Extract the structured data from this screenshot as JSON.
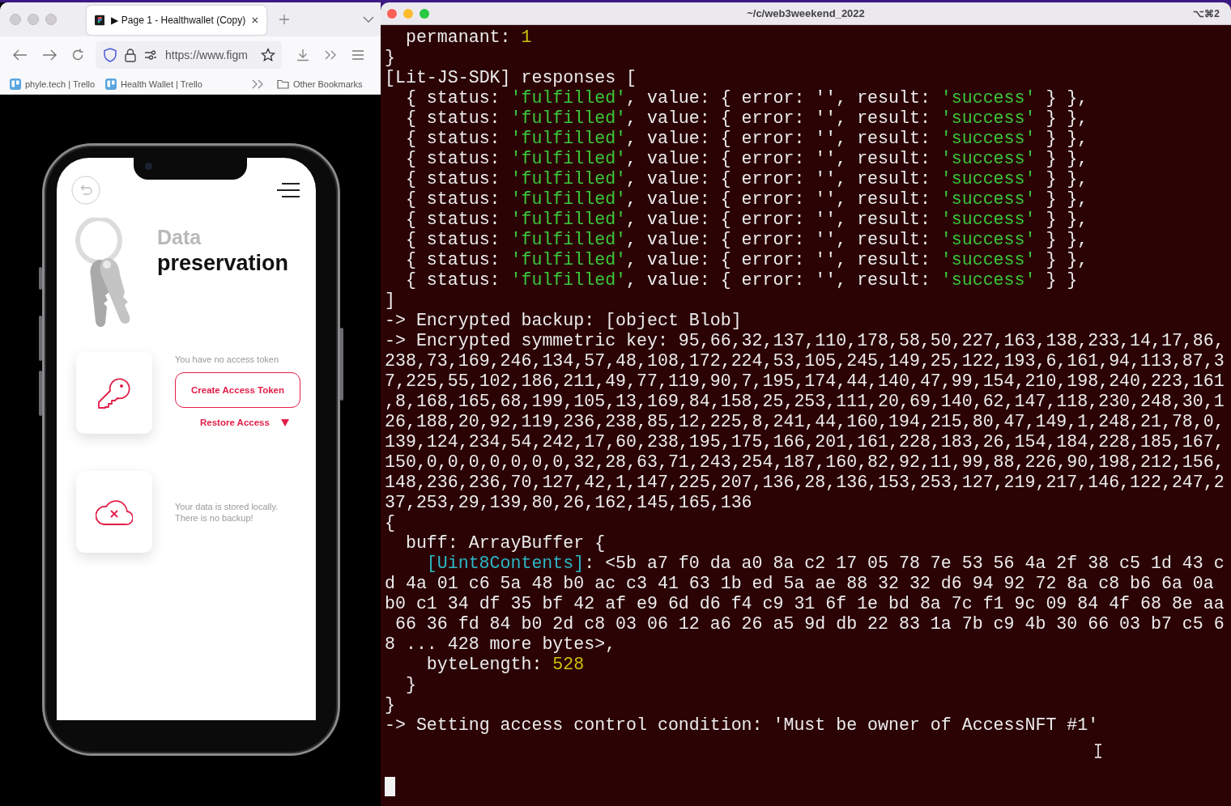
{
  "browser": {
    "tabs": [
      {
        "title": "▶ Page 1 - Healthwallet (Copy)",
        "selected": true
      }
    ],
    "url": "https://www.figm",
    "bookmarks": [
      {
        "label": "phyle.tech | Trello"
      },
      {
        "label": "Health Wallet | Trello"
      }
    ],
    "other_bookmarks": "Other Bookmarks"
  },
  "app": {
    "title_light": "Data",
    "title_bold": "preservation",
    "token_section": {
      "message": "You have no access token",
      "button": "Create Access Token",
      "link": "Restore Access"
    },
    "backup_section": {
      "message": "Your data is stored locally. There is no backup!"
    }
  },
  "terminal": {
    "title": "~/c/web3weekend_2022",
    "shortcut": "⌥⌘2",
    "lines": [
      [
        {
          "text": "  permanant: ",
          "kind": "plain"
        },
        {
          "text": "1",
          "kind": "number"
        }
      ],
      [
        {
          "text": "}",
          "kind": "plain"
        }
      ],
      [
        {
          "text": "[Lit-JS-SDK] responses [",
          "kind": "plain"
        }
      ],
      [
        {
          "text": "  { status: ",
          "kind": "plain"
        },
        {
          "text": "'fulfilled'",
          "kind": "string"
        },
        {
          "text": ", value: { error: '', result: ",
          "kind": "plain"
        },
        {
          "text": "'success'",
          "kind": "string"
        },
        {
          "text": " } },",
          "kind": "plain"
        }
      ],
      [
        {
          "text": "  { status: ",
          "kind": "plain"
        },
        {
          "text": "'fulfilled'",
          "kind": "string"
        },
        {
          "text": ", value: { error: '', result: ",
          "kind": "plain"
        },
        {
          "text": "'success'",
          "kind": "string"
        },
        {
          "text": " } },",
          "kind": "plain"
        }
      ],
      [
        {
          "text": "  { status: ",
          "kind": "plain"
        },
        {
          "text": "'fulfilled'",
          "kind": "string"
        },
        {
          "text": ", value: { error: '', result: ",
          "kind": "plain"
        },
        {
          "text": "'success'",
          "kind": "string"
        },
        {
          "text": " } },",
          "kind": "plain"
        }
      ],
      [
        {
          "text": "  { status: ",
          "kind": "plain"
        },
        {
          "text": "'fulfilled'",
          "kind": "string"
        },
        {
          "text": ", value: { error: '', result: ",
          "kind": "plain"
        },
        {
          "text": "'success'",
          "kind": "string"
        },
        {
          "text": " } },",
          "kind": "plain"
        }
      ],
      [
        {
          "text": "  { status: ",
          "kind": "plain"
        },
        {
          "text": "'fulfilled'",
          "kind": "string"
        },
        {
          "text": ", value: { error: '', result: ",
          "kind": "plain"
        },
        {
          "text": "'success'",
          "kind": "string"
        },
        {
          "text": " } },",
          "kind": "plain"
        }
      ],
      [
        {
          "text": "  { status: ",
          "kind": "plain"
        },
        {
          "text": "'fulfilled'",
          "kind": "string"
        },
        {
          "text": ", value: { error: '', result: ",
          "kind": "plain"
        },
        {
          "text": "'success'",
          "kind": "string"
        },
        {
          "text": " } },",
          "kind": "plain"
        }
      ],
      [
        {
          "text": "  { status: ",
          "kind": "plain"
        },
        {
          "text": "'fulfilled'",
          "kind": "string"
        },
        {
          "text": ", value: { error: '', result: ",
          "kind": "plain"
        },
        {
          "text": "'success'",
          "kind": "string"
        },
        {
          "text": " } },",
          "kind": "plain"
        }
      ],
      [
        {
          "text": "  { status: ",
          "kind": "plain"
        },
        {
          "text": "'fulfilled'",
          "kind": "string"
        },
        {
          "text": ", value: { error: '', result: ",
          "kind": "plain"
        },
        {
          "text": "'success'",
          "kind": "string"
        },
        {
          "text": " } },",
          "kind": "plain"
        }
      ],
      [
        {
          "text": "  { status: ",
          "kind": "plain"
        },
        {
          "text": "'fulfilled'",
          "kind": "string"
        },
        {
          "text": ", value: { error: '', result: ",
          "kind": "plain"
        },
        {
          "text": "'success'",
          "kind": "string"
        },
        {
          "text": " } },",
          "kind": "plain"
        }
      ],
      [
        {
          "text": "  { status: ",
          "kind": "plain"
        },
        {
          "text": "'fulfilled'",
          "kind": "string"
        },
        {
          "text": ", value: { error: '', result: ",
          "kind": "plain"
        },
        {
          "text": "'success'",
          "kind": "string"
        },
        {
          "text": " } }",
          "kind": "plain"
        }
      ],
      [
        {
          "text": "]",
          "kind": "plain"
        }
      ],
      [
        {
          "text": "-> Encrypted backup: [object Blob]",
          "kind": "plain"
        }
      ],
      [
        {
          "text": "-> Encrypted symmetric key: 95,66,32,137,110,178,58,50,227,163,138,233,14,17,86,",
          "kind": "plain"
        }
      ],
      [
        {
          "text": "238,73,169,246,134,57,48,108,172,224,53,105,245,149,25,122,193,6,161,94,113,87,3",
          "kind": "plain"
        }
      ],
      [
        {
          "text": "7,225,55,102,186,211,49,77,119,90,7,195,174,44,140,47,99,154,210,198,240,223,161",
          "kind": "plain"
        }
      ],
      [
        {
          "text": ",8,168,165,68,199,105,13,169,84,158,25,253,111,20,69,140,62,147,118,230,248,30,1",
          "kind": "plain"
        }
      ],
      [
        {
          "text": "26,188,20,92,119,236,238,85,12,225,8,241,44,160,194,215,80,47,149,1,248,21,78,0,",
          "kind": "plain"
        }
      ],
      [
        {
          "text": "139,124,234,54,242,17,60,238,195,175,166,201,161,228,183,26,154,184,228,185,167,",
          "kind": "plain"
        }
      ],
      [
        {
          "text": "150,0,0,0,0,0,0,0,32,28,63,71,243,254,187,160,82,92,11,99,88,226,90,198,212,156,",
          "kind": "plain"
        }
      ],
      [
        {
          "text": "148,236,236,70,127,42,1,147,225,207,136,28,136,153,253,127,219,217,146,122,247,2",
          "kind": "plain"
        }
      ],
      [
        {
          "text": "37,253,29,139,80,26,162,145,165,136",
          "kind": "plain"
        }
      ],
      [
        {
          "text": "{",
          "kind": "plain"
        }
      ],
      [
        {
          "text": "  buff: ArrayBuffer {",
          "kind": "plain"
        }
      ],
      [
        {
          "text": "[Uint8Contents]",
          "kind": "key"
        },
        {
          "text": ": <5b a7 f0 da a0 8a c2 17 05 78 7e 53 56 4a 2f 38 c5 1d 43 c",
          "kind": "plain"
        }
      ],
      [
        {
          "text": "d 4a 01 c6 5a 48 b0 ac c3 41 63 1b ed 5a ae 88 32 32 d6 94 92 72 8a c8 b6 6a 0a",
          "kind": "plain"
        }
      ],
      [
        {
          "text": "b0 c1 34 df 35 bf 42 af e9 6d d6 f4 c9 31 6f 1e bd 8a 7c f1 9c 09 84 4f 68 8e aa",
          "kind": "plain"
        }
      ],
      [
        {
          "text": " 66 36 fd 84 b0 2d c8 03 06 12 a6 26 a5 9d db 22 83 1a 7b c9 4b 30 66 03 b7 c5 6",
          "kind": "plain"
        }
      ],
      [
        {
          "text": "8 ... 428 more bytes>,",
          "kind": "plain"
        }
      ],
      [
        {
          "text": "    byteLength: ",
          "kind": "plain"
        },
        {
          "text": "528",
          "kind": "number"
        }
      ],
      [
        {
          "text": "  }",
          "kind": "plain"
        }
      ],
      [
        {
          "text": "}",
          "kind": "plain"
        }
      ],
      [
        {
          "text": "-> Setting access control condition: 'Must be owner of AccessNFT #1'",
          "kind": "plain"
        }
      ]
    ]
  }
}
